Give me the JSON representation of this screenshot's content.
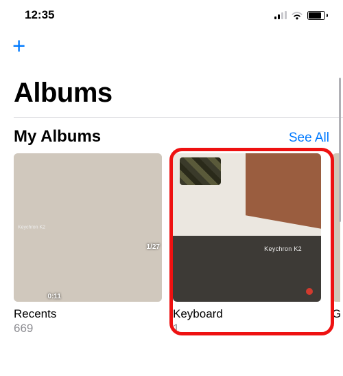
{
  "statusbar": {
    "time": "12:35"
  },
  "nav": {
    "add_label": "+"
  },
  "title": "Albums",
  "section": {
    "title": "My Albums",
    "see_all": "See All"
  },
  "albums": [
    {
      "name": "Recents",
      "count": "669",
      "badges": {
        "date": "1/27",
        "duration": "0:11"
      },
      "box_text": "Keychron K2"
    },
    {
      "name": "Keyboard",
      "count": "1",
      "box_text": "Keychron K2"
    },
    {
      "name": "G",
      "count": ""
    }
  ]
}
